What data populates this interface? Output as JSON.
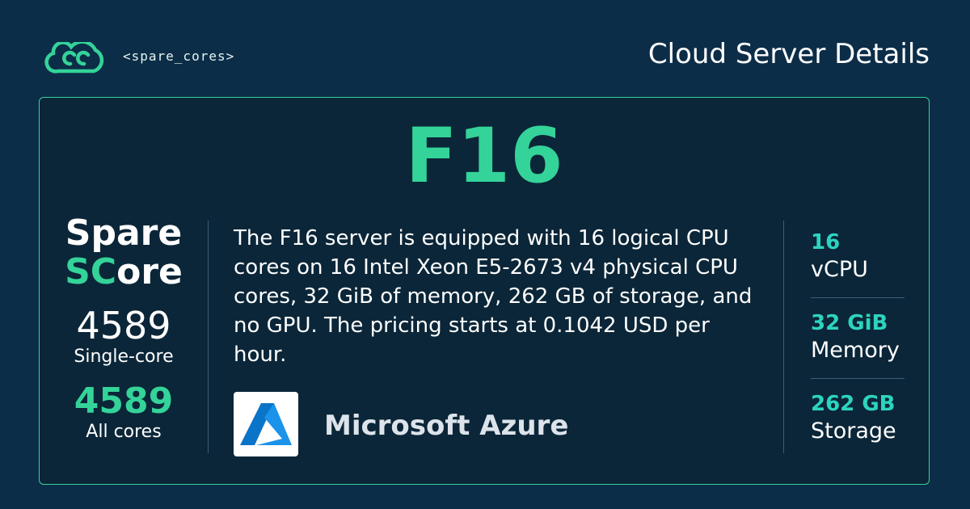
{
  "header": {
    "brand_text": "<spare_cores>",
    "page_heading": "Cloud Server Details"
  },
  "server": {
    "name": "F16",
    "description": "The F16 server is equipped with 16 logical CPU cores on 16 Intel Xeon E5-2673 v4 physical CPU cores, 32 GiB of memory, 262 GB of storage, and no GPU. The pricing starts at 0.1042 USD per hour."
  },
  "score": {
    "brand_line1": "Spare",
    "brand_line2_accent": "SC",
    "brand_line2_rest": "ore",
    "single_core_value": "4589",
    "single_core_label": "Single-core",
    "all_cores_value": "4589",
    "all_cores_label": "All cores"
  },
  "provider": {
    "name": "Microsoft Azure",
    "logo_icon": "azure-logo-icon"
  },
  "specs": [
    {
      "value": "16",
      "label": "vCPU"
    },
    {
      "value": "32 GiB",
      "label": "Memory"
    },
    {
      "value": "262 GB",
      "label": "Storage"
    }
  ],
  "colors": {
    "background": "#0c2d48",
    "card": "#0b2638",
    "accent_green": "#34d399",
    "spec_teal": "#2dd4bf",
    "azure_blue": "#0a74c9"
  }
}
